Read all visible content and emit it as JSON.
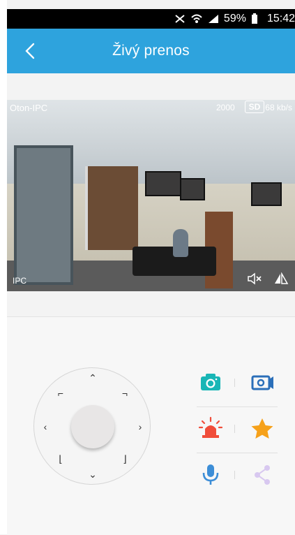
{
  "status_bar": {
    "battery_text": "59%",
    "time": "15:42"
  },
  "header": {
    "title": "Živý prenos"
  },
  "video": {
    "camera_name": "Oton-IPC",
    "timestamp": "2000",
    "quality_badge": "SD",
    "rate": "68 kb/s",
    "watermark": "IPC"
  },
  "colors": {
    "accent": "#2ea3dd",
    "snapshot": "#19b6b6",
    "record": "#2b6fb9",
    "alarm": "#f04d3a",
    "favorite": "#f6a11a",
    "mic": "#3d8ed7",
    "share": "#d8c8f0"
  },
  "icons": [
    "back-icon",
    "signal-icon",
    "wifi-icon",
    "battery-icon",
    "mute-icon",
    "flip-icon",
    "camera-icon",
    "video-record-icon",
    "alarm-icon",
    "star-icon",
    "microphone-icon",
    "share-icon"
  ]
}
